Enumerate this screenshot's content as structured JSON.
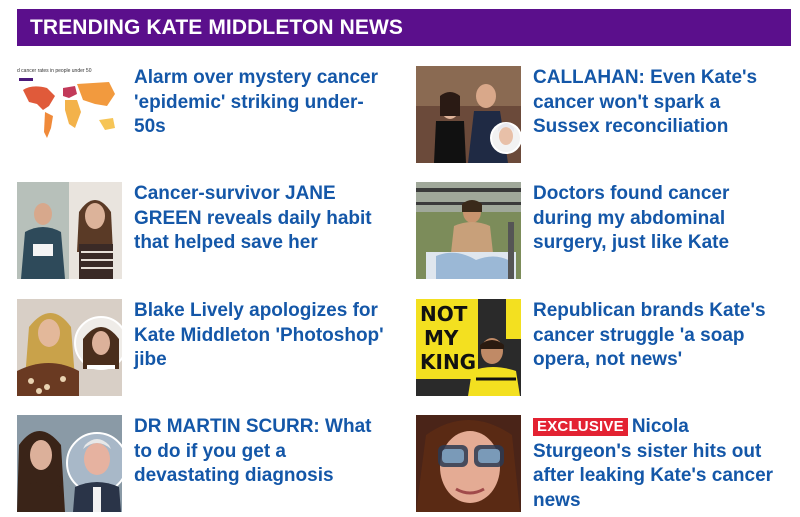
{
  "header": {
    "title": "TRENDING KATE MIDDLETON NEWS"
  },
  "articles": [
    {
      "headline": "Alarm over mystery cancer 'epidemic' striking under-50s",
      "thumb_icon": "world-map-chart-icon",
      "thumb_caption": "d cancer rates in people under 50"
    },
    {
      "headline": "CALLAHAN: Even Kate's cancer won't spark a Sussex reconciliation",
      "thumb_icon": "royal-couple-photo"
    },
    {
      "headline": "Cancer-survivor JANE GREEN reveals daily habit that helped save her",
      "thumb_icon": "portrait-photo"
    },
    {
      "headline": "Doctors found cancer during my abdominal surgery, just like Kate",
      "thumb_icon": "hospital-patient-photo"
    },
    {
      "headline": "Blake Lively apologizes for Kate Middleton 'Photoshop' jibe",
      "thumb_icon": "portrait-photo"
    },
    {
      "headline": "Republican brands Kate's cancer struggle 'a soap opera, not news'",
      "thumb_icon": "protest-sign-photo",
      "sign_lines": [
        "NOT",
        "MY",
        "KING"
      ]
    },
    {
      "headline": "DR MARTIN SCURR: What to do if you get a devastating diagnosis",
      "thumb_icon": "portrait-photo"
    },
    {
      "badge": "EXCLUSIVE",
      "headline": "Nicola Sturgeon's sister hits out after leaking Kate's cancer news",
      "thumb_icon": "selfie-photo"
    }
  ],
  "colors": {
    "header_bg": "#5b0f8c",
    "headline": "#1457a8",
    "badge_bg": "#e32232"
  }
}
